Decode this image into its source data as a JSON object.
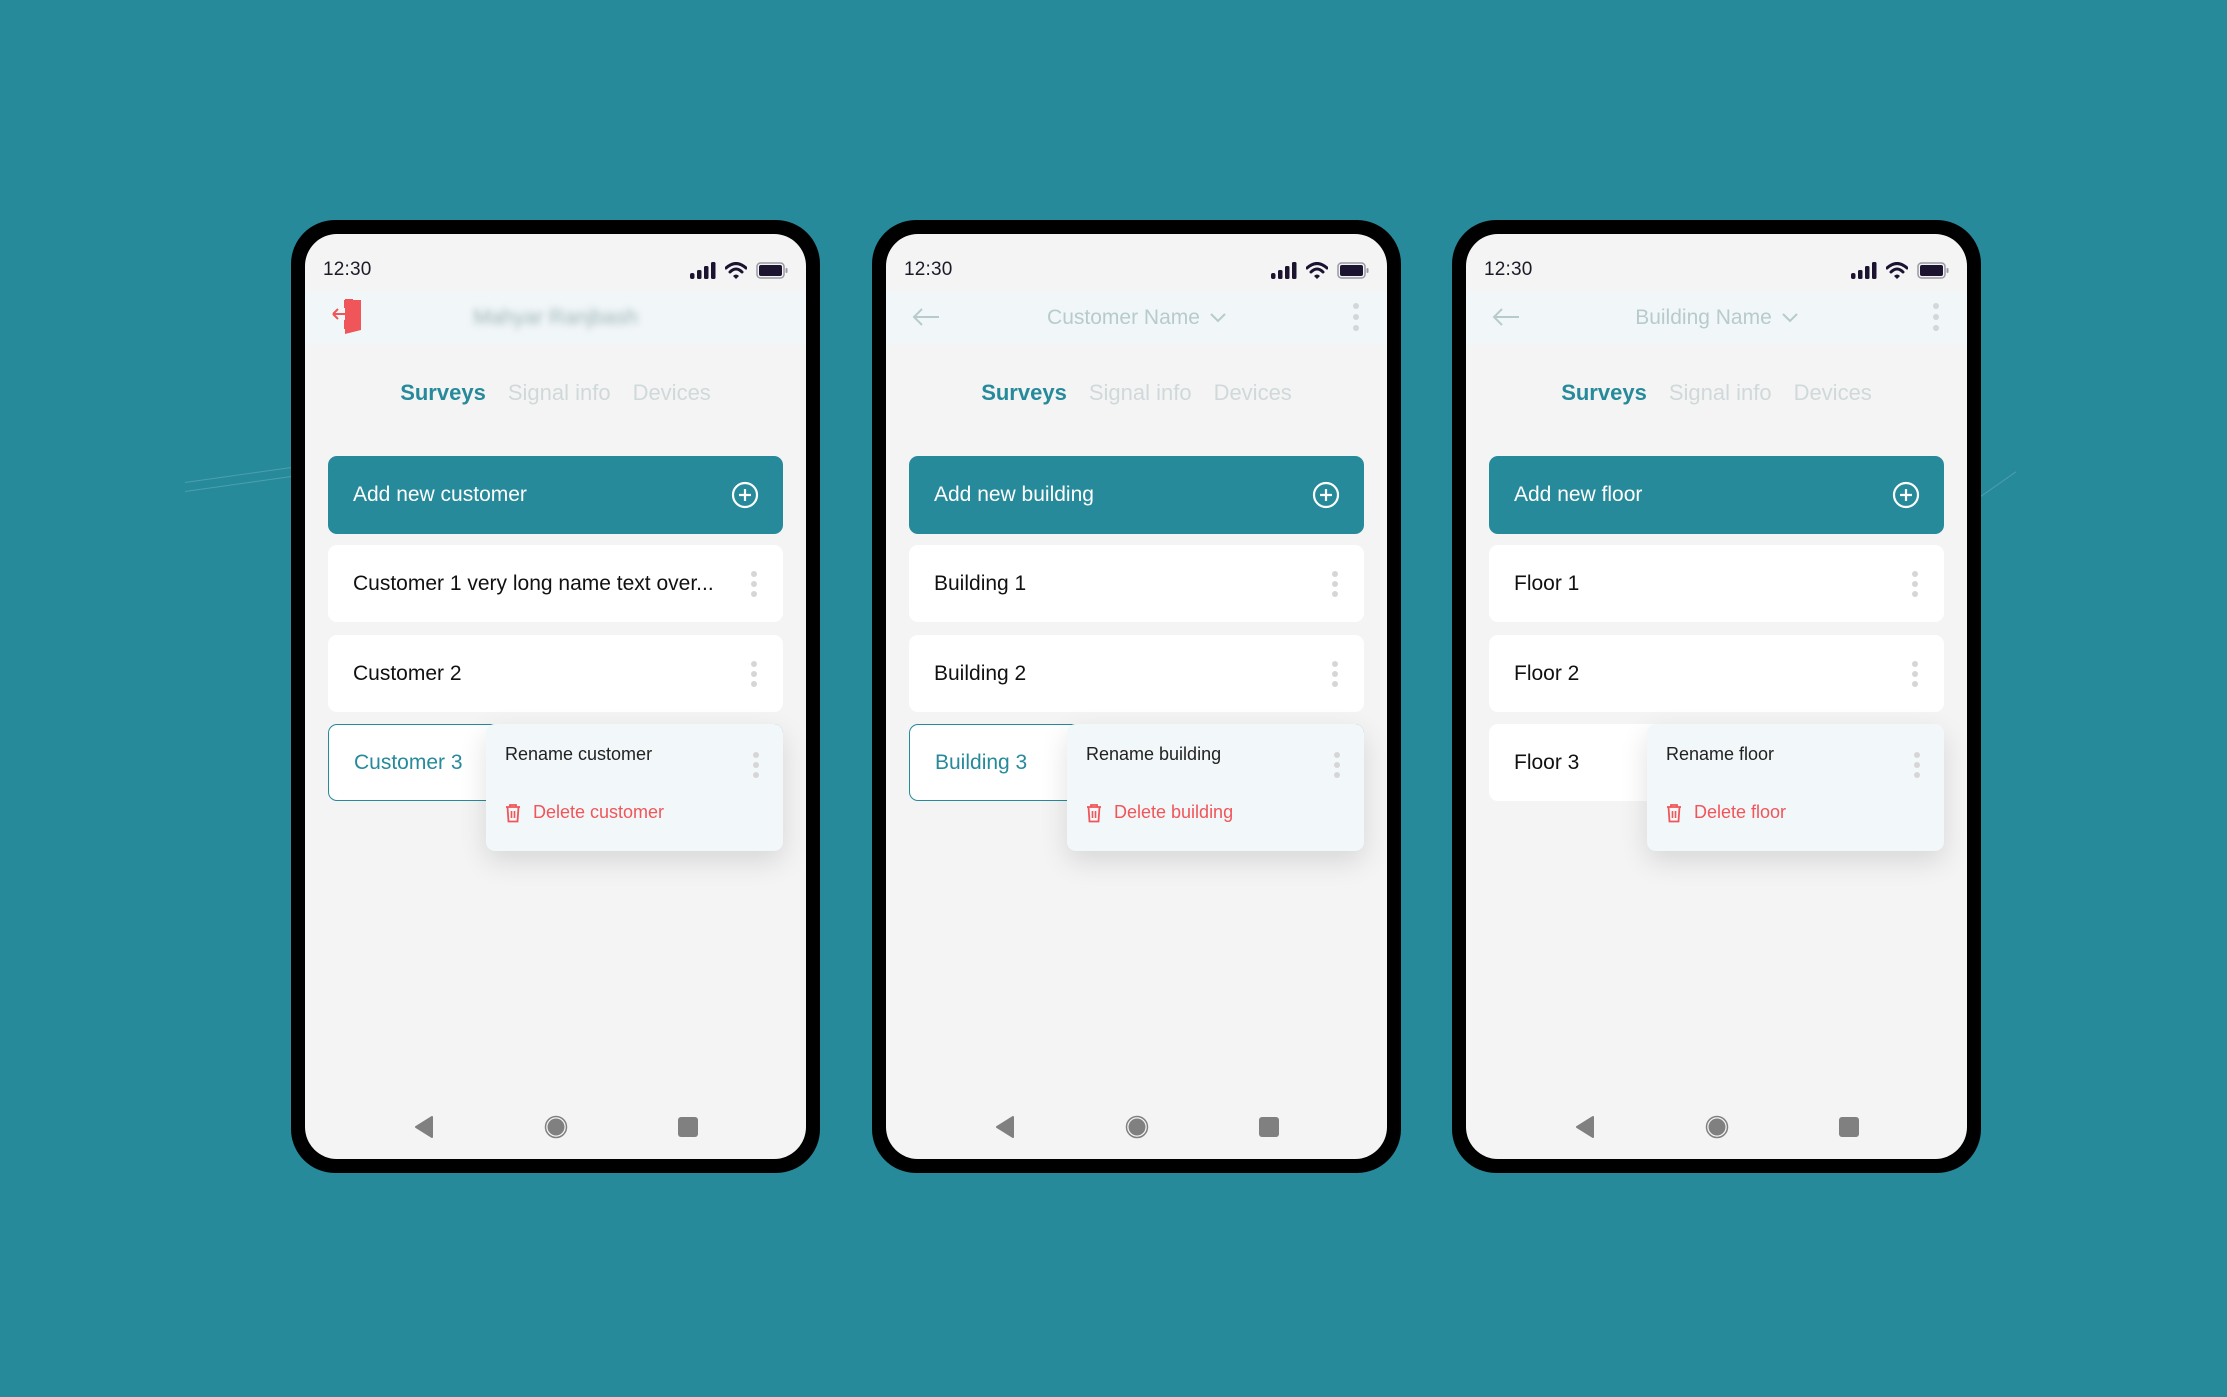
{
  "colors": {
    "background": "#268a9b",
    "accent": "#268a9b",
    "danger": "#f05559",
    "header_text": "#b7cbcd",
    "inactive_tab": "#d0d9da"
  },
  "phones": [
    {
      "status": {
        "time": "12:30"
      },
      "header": {
        "left_icon": "logout-door-icon",
        "title": "Mahyar Ranjbash",
        "title_blurred": true,
        "has_dropdown": false,
        "has_more_menu": false
      },
      "tabs": [
        {
          "label": "Surveys",
          "active": true
        },
        {
          "label": "Signal info",
          "active": false
        },
        {
          "label": "Devices",
          "active": false
        }
      ],
      "add_button": {
        "label": "Add new customer",
        "icon": "plus-circle-icon"
      },
      "items": [
        {
          "label": "Customer 1 very long name text over...",
          "selected": false
        },
        {
          "label": "Customer 2",
          "selected": false
        },
        {
          "label": "Customer 3",
          "selected": true
        }
      ],
      "context_menu": {
        "rename_label": "Rename customer",
        "delete_label": "Delete customer",
        "delete_icon": "trash-icon"
      }
    },
    {
      "status": {
        "time": "12:30"
      },
      "header": {
        "left_icon": "back-arrow-icon",
        "title": "Customer Name",
        "title_blurred": false,
        "has_dropdown": true,
        "has_more_menu": true
      },
      "tabs": [
        {
          "label": "Surveys",
          "active": true
        },
        {
          "label": "Signal info",
          "active": false
        },
        {
          "label": "Devices",
          "active": false
        }
      ],
      "add_button": {
        "label": "Add new building",
        "icon": "plus-circle-icon"
      },
      "items": [
        {
          "label": "Building 1",
          "selected": false
        },
        {
          "label": "Building 2",
          "selected": false
        },
        {
          "label": "Building 3",
          "selected": true
        }
      ],
      "context_menu": {
        "rename_label": "Rename building",
        "delete_label": "Delete building",
        "delete_icon": "trash-icon"
      }
    },
    {
      "status": {
        "time": "12:30"
      },
      "header": {
        "left_icon": "back-arrow-icon",
        "title": "Building Name",
        "title_blurred": false,
        "has_dropdown": true,
        "has_more_menu": true
      },
      "tabs": [
        {
          "label": "Surveys",
          "active": true
        },
        {
          "label": "Signal info",
          "active": false
        },
        {
          "label": "Devices",
          "active": false
        }
      ],
      "add_button": {
        "label": "Add new floor",
        "icon": "plus-circle-icon"
      },
      "items": [
        {
          "label": "Floor 1",
          "selected": false
        },
        {
          "label": "Floor 2",
          "selected": false
        },
        {
          "label": "Floor 3",
          "selected": false
        }
      ],
      "context_menu": {
        "rename_label": "Rename floor",
        "delete_label": "Delete floor",
        "delete_icon": "trash-icon"
      }
    }
  ],
  "navbar": {
    "back": "nav-back-icon",
    "home": "nav-home-icon",
    "recents": "nav-recents-icon"
  }
}
